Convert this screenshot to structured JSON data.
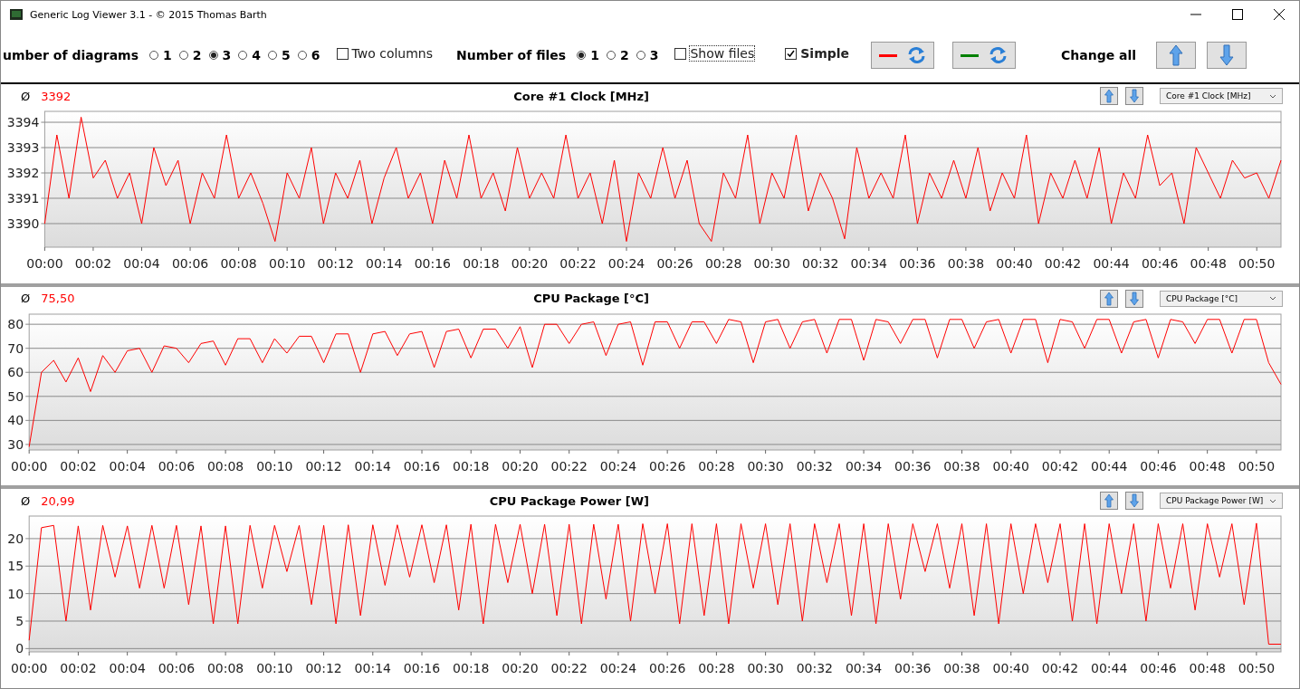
{
  "window": {
    "title": "Generic Log Viewer 3.1 - © 2015 Thomas Barth"
  },
  "toolbar": {
    "diagrams": {
      "label": "umber of diagrams",
      "options": [
        {
          "label": "1",
          "selected": false
        },
        {
          "label": "2",
          "selected": false
        },
        {
          "label": "3",
          "selected": true
        },
        {
          "label": "4",
          "selected": false
        },
        {
          "label": "5",
          "selected": false
        },
        {
          "label": "6",
          "selected": false
        }
      ]
    },
    "two_columns": {
      "label": "Two columns",
      "checked": false
    },
    "files": {
      "label": "Number of files",
      "options": [
        {
          "label": "1",
          "selected": true
        },
        {
          "label": "2",
          "selected": false
        },
        {
          "label": "3",
          "selected": false
        }
      ]
    },
    "show_files": {
      "label": "Show files",
      "checked": false
    },
    "simple": {
      "label": "Simple",
      "checked": true
    },
    "color_buttons": [
      {
        "color": "#ff0000"
      },
      {
        "color": "#008000"
      }
    ],
    "change_all": {
      "label": "Change all"
    }
  },
  "diagrams": [
    {
      "avg_symbol": "Ø",
      "average": "3392",
      "title": "Core #1 Clock [MHz]",
      "selector": "Core #1 Clock [MHz]",
      "chart_data": {
        "type": "line",
        "grid": true,
        "xlim": [
          0,
          51
        ],
        "ylim": [
          3389.07,
          3394.43
        ],
        "yticks": [
          3390,
          3391,
          3392,
          3393,
          3394
        ],
        "xticks": [
          {
            "value": 0,
            "label": "00:00"
          },
          {
            "value": 2,
            "label": "00:02"
          },
          {
            "value": 4,
            "label": "00:04"
          },
          {
            "value": 6,
            "label": "00:06"
          },
          {
            "value": 8,
            "label": "00:08"
          },
          {
            "value": 10,
            "label": "00:10"
          },
          {
            "value": 12,
            "label": "00:12"
          },
          {
            "value": 14,
            "label": "00:14"
          },
          {
            "value": 16,
            "label": "00:16"
          },
          {
            "value": 18,
            "label": "00:18"
          },
          {
            "value": 20,
            "label": "00:20"
          },
          {
            "value": 22,
            "label": "00:22"
          },
          {
            "value": 24,
            "label": "00:24"
          },
          {
            "value": 26,
            "label": "00:26"
          },
          {
            "value": 28,
            "label": "00:28"
          },
          {
            "value": 30,
            "label": "00:30"
          },
          {
            "value": 32,
            "label": "00:32"
          },
          {
            "value": 34,
            "label": "00:34"
          },
          {
            "value": 36,
            "label": "00:36"
          },
          {
            "value": 38,
            "label": "00:38"
          },
          {
            "value": 40,
            "label": "00:40"
          },
          {
            "value": 42,
            "label": "00:42"
          },
          {
            "value": 44,
            "label": "00:44"
          },
          {
            "value": 46,
            "label": "00:46"
          },
          {
            "value": 48,
            "label": "00:48"
          },
          {
            "value": 50,
            "label": "00:50"
          }
        ],
        "x": [
          0,
          0.5,
          1,
          1.5,
          2,
          2.5,
          3,
          3.5,
          4,
          4.5,
          5,
          5.5,
          6,
          6.5,
          7,
          7.5,
          8,
          8.5,
          9,
          9.5,
          10,
          10.5,
          11,
          11.5,
          12,
          12.5,
          13,
          13.5,
          14,
          14.5,
          15,
          15.5,
          16,
          16.5,
          17,
          17.5,
          18,
          18.5,
          19,
          19.5,
          20,
          20.5,
          21,
          21.5,
          22,
          22.5,
          23,
          23.5,
          24,
          24.5,
          25,
          25.5,
          26,
          26.5,
          27,
          27.5,
          28,
          28.5,
          29,
          29.5,
          30,
          30.5,
          31,
          31.5,
          32,
          32.5,
          33,
          33.5,
          34,
          34.5,
          35,
          35.5,
          36,
          36.5,
          37,
          37.5,
          38,
          38.5,
          39,
          39.5,
          40,
          40.5,
          41,
          41.5,
          42,
          42.5,
          43,
          43.5,
          44,
          44.5,
          45,
          45.5,
          46,
          46.5,
          47,
          47.5,
          48,
          48.5,
          49,
          49.5,
          50,
          50.5,
          51
        ],
        "series": [
          {
            "color": "#ff0000",
            "values": [
              3390,
              3393.5,
              3391,
              3394.2,
              3391.8,
              3392.5,
              3391,
              3392,
              3390,
              3393,
              3391.5,
              3392.5,
              3390,
              3392,
              3391,
              3393.5,
              3391,
              3392,
              3390.8,
              3389.3,
              3392,
              3391,
              3393,
              3390,
              3392,
              3391,
              3392.5,
              3390,
              3391.8,
              3393,
              3391,
              3392,
              3390,
              3392.5,
              3391,
              3393.5,
              3391,
              3392,
              3390.5,
              3393,
              3391,
              3392,
              3391,
              3393.5,
              3391,
              3392,
              3390,
              3392.5,
              3389.3,
              3392,
              3391,
              3393,
              3391,
              3392.5,
              3390,
              3389.3,
              3392,
              3391,
              3393.5,
              3390,
              3392,
              3391,
              3393.5,
              3390.5,
              3392,
              3391,
              3389.4,
              3393,
              3391,
              3392,
              3391,
              3393.5,
              3390,
              3392,
              3391,
              3392.5,
              3391,
              3393,
              3390.5,
              3392,
              3391,
              3393.5,
              3390,
              3392,
              3391,
              3392.5,
              3391,
              3393,
              3390,
              3392,
              3391,
              3393.5,
              3391.5,
              3392,
              3390,
              3393,
              3392,
              3391,
              3392.5,
              3391.8,
              3392,
              3391,
              3392.5
            ]
          }
        ]
      }
    },
    {
      "avg_symbol": "Ø",
      "average": "75,50",
      "title": "CPU Package [°C]",
      "selector": "CPU Package [°C]",
      "chart_data": {
        "type": "line",
        "grid": true,
        "xlim": [
          0,
          51
        ],
        "ylim": [
          27.7,
          84.2
        ],
        "yticks": [
          30,
          40,
          50,
          60,
          70,
          80
        ],
        "xticks": [
          {
            "value": 0,
            "label": "00:00"
          },
          {
            "value": 2,
            "label": "00:02"
          },
          {
            "value": 4,
            "label": "00:04"
          },
          {
            "value": 6,
            "label": "00:06"
          },
          {
            "value": 8,
            "label": "00:08"
          },
          {
            "value": 10,
            "label": "00:10"
          },
          {
            "value": 12,
            "label": "00:12"
          },
          {
            "value": 14,
            "label": "00:14"
          },
          {
            "value": 16,
            "label": "00:16"
          },
          {
            "value": 18,
            "label": "00:18"
          },
          {
            "value": 20,
            "label": "00:20"
          },
          {
            "value": 22,
            "label": "00:22"
          },
          {
            "value": 24,
            "label": "00:24"
          },
          {
            "value": 26,
            "label": "00:26"
          },
          {
            "value": 28,
            "label": "00:28"
          },
          {
            "value": 30,
            "label": "00:30"
          },
          {
            "value": 32,
            "label": "00:32"
          },
          {
            "value": 34,
            "label": "00:34"
          },
          {
            "value": 36,
            "label": "00:36"
          },
          {
            "value": 38,
            "label": "00:38"
          },
          {
            "value": 40,
            "label": "00:40"
          },
          {
            "value": 42,
            "label": "00:42"
          },
          {
            "value": 44,
            "label": "00:44"
          },
          {
            "value": 46,
            "label": "00:46"
          },
          {
            "value": 48,
            "label": "00:48"
          },
          {
            "value": 50,
            "label": "00:50"
          }
        ],
        "x": [
          0,
          0.5,
          1,
          1.5,
          2,
          2.5,
          3,
          3.5,
          4,
          4.5,
          5,
          5.5,
          6,
          6.5,
          7,
          7.5,
          8,
          8.5,
          9,
          9.5,
          10,
          10.5,
          11,
          11.5,
          12,
          12.5,
          13,
          13.5,
          14,
          14.5,
          15,
          15.5,
          16,
          16.5,
          17,
          17.5,
          18,
          18.5,
          19,
          19.5,
          20,
          20.5,
          21,
          21.5,
          22,
          22.5,
          23,
          23.5,
          24,
          24.5,
          25,
          25.5,
          26,
          26.5,
          27,
          27.5,
          28,
          28.5,
          29,
          29.5,
          30,
          30.5,
          31,
          31.5,
          32,
          32.5,
          33,
          33.5,
          34,
          34.5,
          35,
          35.5,
          36,
          36.5,
          37,
          37.5,
          38,
          38.5,
          39,
          39.5,
          40,
          40.5,
          41,
          41.5,
          42,
          42.5,
          43,
          43.5,
          44,
          44.5,
          45,
          45.5,
          46,
          46.5,
          47,
          47.5,
          48,
          48.5,
          49,
          49.5,
          50,
          50.5,
          51
        ],
        "series": [
          {
            "color": "#ff0000",
            "values": [
              29,
              60,
              65,
              56,
              66,
              52,
              67,
              60,
              69,
              70,
              60,
              71,
              70,
              64,
              72,
              73,
              63,
              74,
              74,
              64,
              74,
              68,
              75,
              75,
              64,
              76,
              76,
              60,
              76,
              77,
              67,
              76,
              77,
              62,
              77,
              78,
              66,
              78,
              78,
              70,
              79,
              62,
              80,
              80,
              72,
              80,
              81,
              67,
              80,
              81,
              63,
              81,
              81,
              70,
              81,
              81,
              72,
              82,
              81,
              64,
              81,
              82,
              70,
              81,
              82,
              68,
              82,
              82,
              65,
              82,
              81,
              72,
              82,
              82,
              66,
              82,
              82,
              70,
              81,
              82,
              68,
              82,
              82,
              64,
              82,
              81,
              70,
              82,
              82,
              68,
              81,
              82,
              66,
              82,
              81,
              72,
              82,
              82,
              68,
              82,
              82,
              64,
              55
            ]
          }
        ]
      }
    },
    {
      "avg_symbol": "Ø",
      "average": "20,99",
      "title": "CPU Package Power [W]",
      "selector": "CPU Package Power [W]",
      "chart_data": {
        "type": "line",
        "grid": true,
        "xlim": [
          0,
          51
        ],
        "ylim": [
          -0.6,
          24.1
        ],
        "yticks": [
          0,
          5,
          10,
          15,
          20
        ],
        "xticks": [
          {
            "value": 0,
            "label": "00:00"
          },
          {
            "value": 2,
            "label": "00:02"
          },
          {
            "value": 4,
            "label": "00:04"
          },
          {
            "value": 6,
            "label": "00:06"
          },
          {
            "value": 8,
            "label": "00:08"
          },
          {
            "value": 10,
            "label": "00:10"
          },
          {
            "value": 12,
            "label": "00:12"
          },
          {
            "value": 14,
            "label": "00:14"
          },
          {
            "value": 16,
            "label": "00:16"
          },
          {
            "value": 18,
            "label": "00:18"
          },
          {
            "value": 20,
            "label": "00:20"
          },
          {
            "value": 22,
            "label": "00:22"
          },
          {
            "value": 24,
            "label": "00:24"
          },
          {
            "value": 26,
            "label": "00:26"
          },
          {
            "value": 28,
            "label": "00:28"
          },
          {
            "value": 30,
            "label": "00:30"
          },
          {
            "value": 32,
            "label": "00:32"
          },
          {
            "value": 34,
            "label": "00:34"
          },
          {
            "value": 36,
            "label": "00:36"
          },
          {
            "value": 38,
            "label": "00:38"
          },
          {
            "value": 40,
            "label": "00:40"
          },
          {
            "value": 42,
            "label": "00:42"
          },
          {
            "value": 44,
            "label": "00:44"
          },
          {
            "value": 46,
            "label": "00:46"
          },
          {
            "value": 48,
            "label": "00:48"
          },
          {
            "value": 50,
            "label": "00:50"
          }
        ],
        "x": [
          0,
          0.5,
          1,
          1.5,
          2,
          2.5,
          3,
          3.5,
          4,
          4.5,
          5,
          5.5,
          6,
          6.5,
          7,
          7.5,
          8,
          8.5,
          9,
          9.5,
          10,
          10.5,
          11,
          11.5,
          12,
          12.5,
          13,
          13.5,
          14,
          14.5,
          15,
          15.5,
          16,
          16.5,
          17,
          17.5,
          18,
          18.5,
          19,
          19.5,
          20,
          20.5,
          21,
          21.5,
          22,
          22.5,
          23,
          23.5,
          24,
          24.5,
          25,
          25.5,
          26,
          26.5,
          27,
          27.5,
          28,
          28.5,
          29,
          29.5,
          30,
          30.5,
          31,
          31.5,
          32,
          32.5,
          33,
          33.5,
          34,
          34.5,
          35,
          35.5,
          36,
          36.5,
          37,
          37.5,
          38,
          38.5,
          39,
          39.5,
          40,
          40.5,
          41,
          41.5,
          42,
          42.5,
          43,
          43.5,
          44,
          44.5,
          45,
          45.5,
          46,
          46.5,
          47,
          47.5,
          48,
          48.5,
          49,
          49.5,
          50,
          50.5,
          51
        ],
        "series": [
          {
            "color": "#ff0000",
            "values": [
              1.5,
              22,
              22.4,
              5,
              22.3,
              7,
              22.4,
              13,
              22.3,
              11,
              22.4,
              11,
              22.4,
              8,
              22.3,
              4.5,
              22.3,
              4.5,
              22.4,
              11,
              22.4,
              14,
              22.4,
              8,
              22.4,
              4.5,
              22.5,
              6,
              22.5,
              11.5,
              22.5,
              13,
              22.5,
              12,
              22.5,
              7,
              22.6,
              4.5,
              22.6,
              12,
              22.6,
              10,
              22.6,
              6,
              22.6,
              4.5,
              22.6,
              9,
              22.6,
              5,
              22.7,
              10,
              22.7,
              4.5,
              22.7,
              6,
              22.7,
              4.5,
              22.7,
              11,
              22.7,
              8,
              22.7,
              5,
              22.7,
              12,
              22.7,
              6,
              22.7,
              4.5,
              22.7,
              9,
              22.7,
              14,
              22.7,
              11,
              22.7,
              6,
              22.7,
              4.5,
              22.7,
              10,
              22.7,
              12,
              22.7,
              5,
              22.7,
              4.5,
              22.7,
              10,
              22.7,
              5,
              22.7,
              11,
              22.7,
              7,
              22.7,
              13,
              22.7,
              8,
              22.8,
              0.8,
              0.8
            ]
          }
        ]
      }
    }
  ]
}
